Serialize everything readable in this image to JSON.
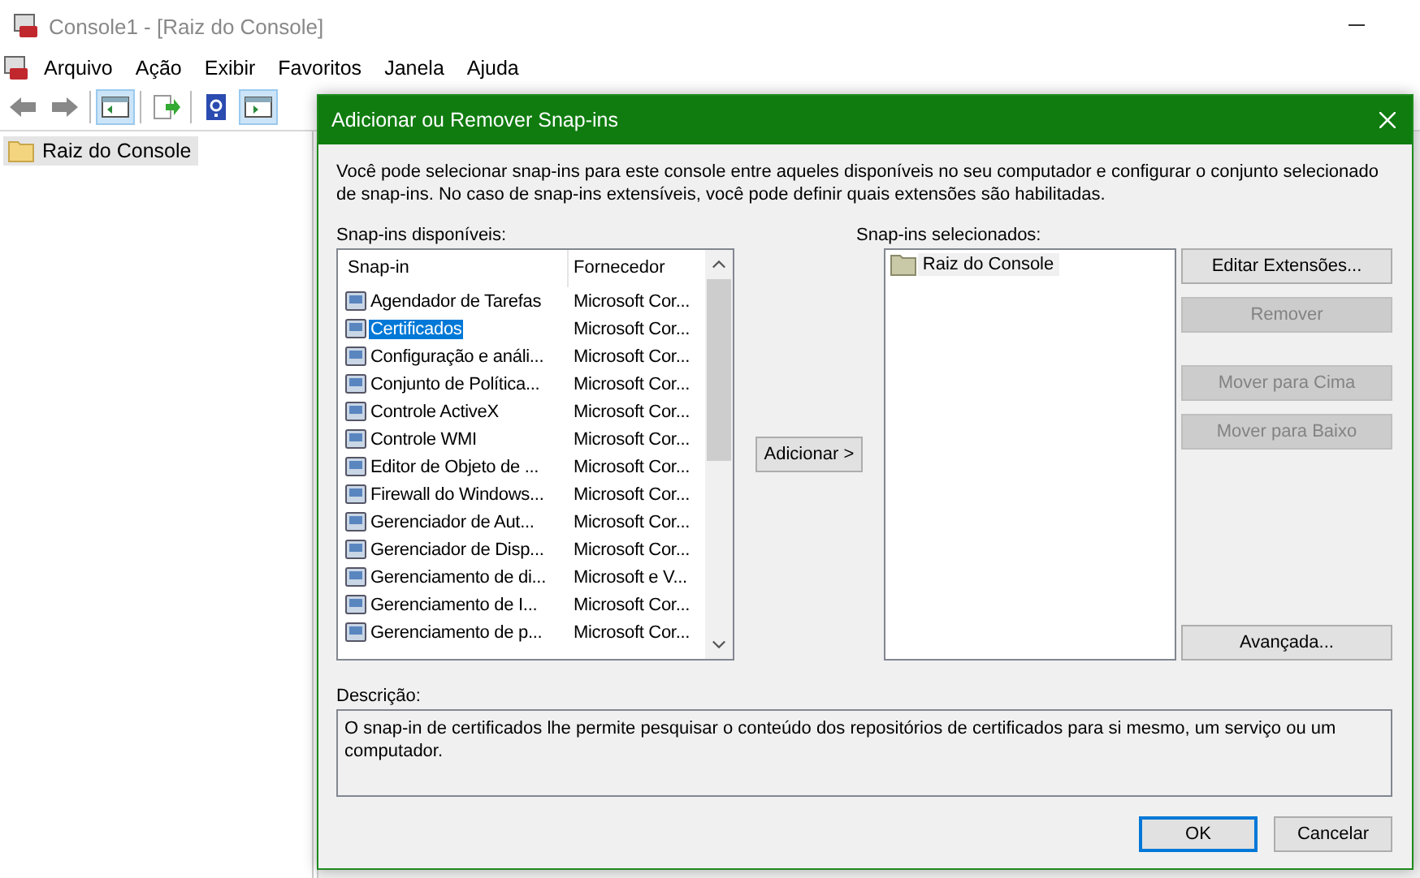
{
  "window": {
    "title": "Console1 - [Raiz do Console]"
  },
  "menu": [
    "Arquivo",
    "Ação",
    "Exibir",
    "Favoritos",
    "Janela",
    "Ajuda"
  ],
  "tree": [
    {
      "label": "Raiz do Console",
      "selected": true
    }
  ],
  "dialog": {
    "title": "Adicionar ou Remover Snap-ins",
    "intro": "Você pode selecionar snap-ins para este console entre aqueles disponíveis no seu computador e configurar o conjunto selecionado de snap-ins. No caso de snap-ins extensíveis, você pode definir quais extensões são habilitadas.",
    "available_label": "Snap-ins disponíveis:",
    "columns": [
      "Snap-in",
      "Fornecedor"
    ],
    "rows": [
      {
        "name": "Agendador de Tarefas",
        "vendor": "Microsoft Cor...",
        "selected": false
      },
      {
        "name": "Certificados",
        "vendor": "Microsoft Cor...",
        "selected": true
      },
      {
        "name": "Configuração e análi...",
        "vendor": "Microsoft Cor...",
        "selected": false
      },
      {
        "name": "Conjunto de Política...",
        "vendor": "Microsoft Cor...",
        "selected": false
      },
      {
        "name": "Controle ActiveX",
        "vendor": "Microsoft Cor...",
        "selected": false
      },
      {
        "name": "Controle WMI",
        "vendor": "Microsoft Cor...",
        "selected": false
      },
      {
        "name": "Editor de Objeto de ...",
        "vendor": "Microsoft Cor...",
        "selected": false
      },
      {
        "name": "Firewall do Windows...",
        "vendor": "Microsoft Cor...",
        "selected": false
      },
      {
        "name": "Gerenciador de Aut...",
        "vendor": "Microsoft Cor...",
        "selected": false
      },
      {
        "name": "Gerenciador de Disp...",
        "vendor": "Microsoft Cor...",
        "selected": false
      },
      {
        "name": "Gerenciamento de di...",
        "vendor": "Microsoft e V...",
        "selected": false
      },
      {
        "name": "Gerenciamento de I...",
        "vendor": "Microsoft Cor...",
        "selected": false
      },
      {
        "name": "Gerenciamento de p...",
        "vendor": "Microsoft Cor...",
        "selected": false
      }
    ],
    "add_button": "Adicionar >",
    "selected_label": "Snap-ins selecionados:",
    "selected_items": [
      {
        "label": "Raiz do Console",
        "selected": true
      }
    ],
    "side_button_groups": [
      [
        {
          "label": "Editar Extensões...",
          "disabled": false
        },
        {
          "label": "Remover",
          "disabled": true
        }
      ],
      [
        {
          "label": "Mover para Cima",
          "disabled": true
        },
        {
          "label": "Mover para Baixo",
          "disabled": true
        }
      ],
      [
        {
          "label": "Avançada...",
          "disabled": false
        }
      ]
    ],
    "description_label": "Descrição:",
    "description": "O snap-in de certificados lhe permite pesquisar o conteúdo dos repositórios de certificados para si mesmo, um serviço ou um computador.",
    "buttons": [
      {
        "label": "OK",
        "default": true
      },
      {
        "label": "Cancelar",
        "default": false
      }
    ]
  }
}
